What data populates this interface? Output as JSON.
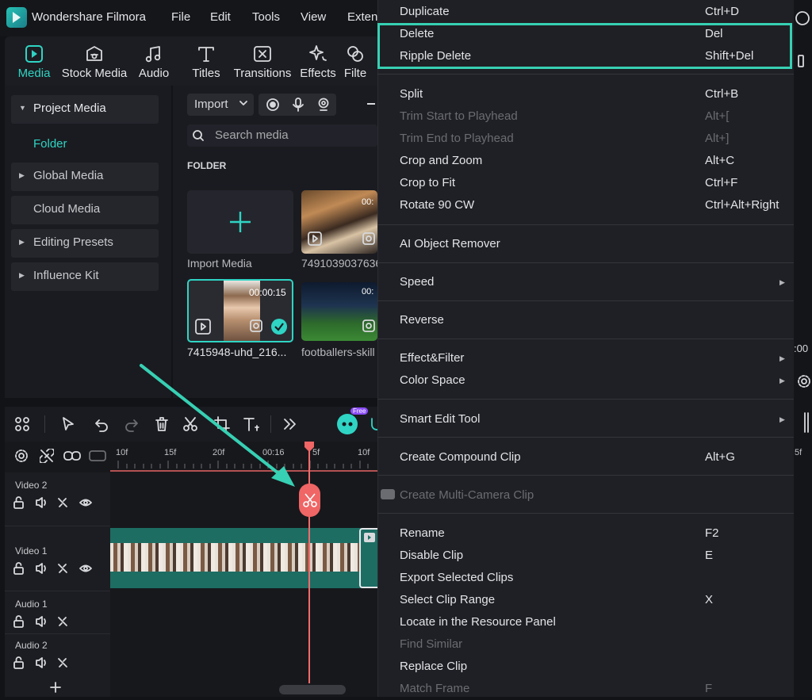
{
  "app": {
    "name": "Wondershare Filmora"
  },
  "menubar": [
    "File",
    "Edit",
    "Tools",
    "View",
    "Exten"
  ],
  "toolbar": {
    "tabs": [
      {
        "label": "Media",
        "icon": "media-icon",
        "active": true
      },
      {
        "label": "Stock Media",
        "icon": "stock-media-icon"
      },
      {
        "label": "Audio",
        "icon": "music-note-icon"
      },
      {
        "label": "Titles",
        "icon": "title-T-icon"
      },
      {
        "label": "Transitions",
        "icon": "transition-icon"
      },
      {
        "label": "Effects",
        "icon": "sparkle-icon"
      },
      {
        "label": "Filte",
        "icon": "filter-icon"
      }
    ]
  },
  "sidebar": {
    "items": [
      {
        "label": "Project Media",
        "expanded": true
      },
      {
        "label": "Folder",
        "selected": true
      },
      {
        "label": "Global Media"
      },
      {
        "label": "Cloud Media"
      },
      {
        "label": "Editing Presets"
      },
      {
        "label": "Influence Kit"
      }
    ]
  },
  "media": {
    "import_label": "Import",
    "search_placeholder": "Search media",
    "section_title": "FOLDER",
    "items": [
      {
        "label": "Import Media"
      },
      {
        "label": "7491039037636",
        "duration": "00:"
      },
      {
        "label": "7415948-uhd_216...",
        "duration": "00:00:15",
        "selected": true
      },
      {
        "label": "footballers-skill",
        "duration": "00:"
      }
    ]
  },
  "timeline": {
    "ruler_labels": [
      "10f",
      "15f",
      "20f",
      "00:16",
      "5f",
      "10f"
    ],
    "tracks": [
      {
        "name": "Video 2"
      },
      {
        "name": "Video 1"
      },
      {
        "name": "Audio 1"
      },
      {
        "name": "Audio 2"
      }
    ],
    "ai_badge": "Free"
  },
  "context_menu": {
    "items": [
      {
        "label": "Duplicate",
        "shortcut": "Ctrl+D"
      },
      {
        "label": "Delete",
        "shortcut": "Del"
      },
      {
        "label": "Ripple Delete",
        "shortcut": "Shift+Del"
      },
      {
        "label": "Split",
        "shortcut": "Ctrl+B"
      },
      {
        "label": "Trim Start to Playhead",
        "shortcut": "Alt+[",
        "disabled": true
      },
      {
        "label": "Trim End to Playhead",
        "shortcut": "Alt+]",
        "disabled": true
      },
      {
        "label": "Crop and Zoom",
        "shortcut": "Alt+C"
      },
      {
        "label": "Crop to Fit",
        "shortcut": "Ctrl+F"
      },
      {
        "label": "Rotate 90 CW",
        "shortcut": "Ctrl+Alt+Right"
      },
      {
        "label": "AI Object Remover",
        "shortcut": ""
      },
      {
        "label": "Speed",
        "shortcut": "",
        "submenu": true
      },
      {
        "label": "Reverse",
        "shortcut": ""
      },
      {
        "label": "Effect&Filter",
        "shortcut": "",
        "submenu": true
      },
      {
        "label": "Color Space",
        "shortcut": "",
        "submenu": true
      },
      {
        "label": "Smart Edit Tool",
        "shortcut": "",
        "submenu": true
      },
      {
        "label": "Create Compound Clip",
        "shortcut": "Alt+G"
      },
      {
        "label": "Create Multi-Camera Clip",
        "shortcut": "",
        "disabled": true
      },
      {
        "label": "Rename",
        "shortcut": "F2"
      },
      {
        "label": "Disable Clip",
        "shortcut": "E"
      },
      {
        "label": "Export Selected Clips",
        "shortcut": ""
      },
      {
        "label": "Select Clip Range",
        "shortcut": "X"
      },
      {
        "label": "Locate in the Resource Panel",
        "shortcut": ""
      },
      {
        "label": "Find Similar",
        "shortcut": "",
        "disabled": true
      },
      {
        "label": "Replace Clip",
        "shortcut": ""
      },
      {
        "label": "Match Frame",
        "shortcut": "F",
        "disabled": true
      }
    ]
  },
  "right_edge": {
    "time_fragment": ":00"
  },
  "colors": {
    "accent": "#2fd4c4",
    "highlight": "#37d0b4",
    "playhead": "#f06565"
  }
}
